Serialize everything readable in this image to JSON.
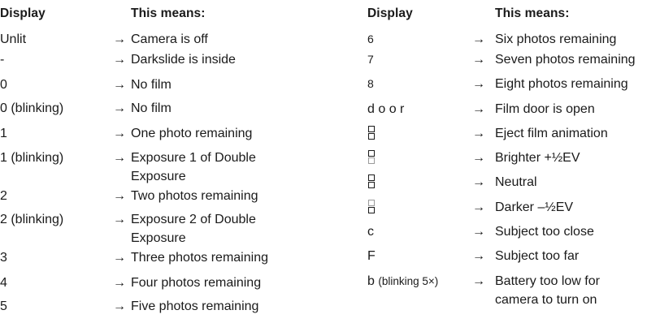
{
  "headers": {
    "display": "Display",
    "means": "This means:"
  },
  "arrow": "→",
  "left": [
    {
      "display": "Unlit",
      "means": [
        "Camera is off"
      ]
    },
    {
      "display": "-",
      "means": [
        "Darkslide is inside"
      ]
    },
    {
      "display": "0",
      "means": [
        "No film"
      ]
    },
    {
      "display": "0 (blinking)",
      "means": [
        "No film"
      ]
    },
    {
      "display": "1",
      "means": [
        "One photo remaining"
      ]
    },
    {
      "display": "1 (blinking)",
      "means": [
        "Exposure 1 of Double",
        "Exposure"
      ]
    },
    {
      "display": "2",
      "means": [
        "Two photos remaining"
      ]
    },
    {
      "display": "2 (blinking)",
      "means": [
        "Exposure 2 of Double",
        "Exposure"
      ]
    },
    {
      "display": "3",
      "means": [
        "Three photos remaining"
      ]
    },
    {
      "display": "4",
      "means": [
        "Four photos remaining"
      ]
    },
    {
      "display": "5",
      "means": [
        "Five photos remaining"
      ]
    }
  ],
  "right": [
    {
      "display": "6",
      "means": [
        "Six photos remaining"
      ]
    },
    {
      "display": "7",
      "means": [
        "Seven photos remaining"
      ]
    },
    {
      "display": "8",
      "means": [
        "Eight photos remaining"
      ]
    },
    {
      "display": "d o o r",
      "means": [
        "Film door is open"
      ]
    },
    {
      "display": "",
      "icon": "eject-animation-icon",
      "means": [
        "Eject film animation"
      ]
    },
    {
      "display": "",
      "icon": "brighter-segment-icon",
      "means": [
        "Brighter +½EV"
      ]
    },
    {
      "display": "",
      "icon": "neutral-segment-icon",
      "means": [
        "Neutral"
      ]
    },
    {
      "display": "",
      "icon": "darker-segment-icon",
      "means": [
        "Darker –½EV"
      ]
    },
    {
      "display": "c",
      "means": [
        "Subject too close"
      ]
    },
    {
      "display": "F",
      "means": [
        "Subject too far"
      ]
    },
    {
      "display": "b",
      "display_suffix": "(blinking 5×)",
      "means": [
        "Battery too low for",
        "camera to turn on"
      ]
    }
  ]
}
